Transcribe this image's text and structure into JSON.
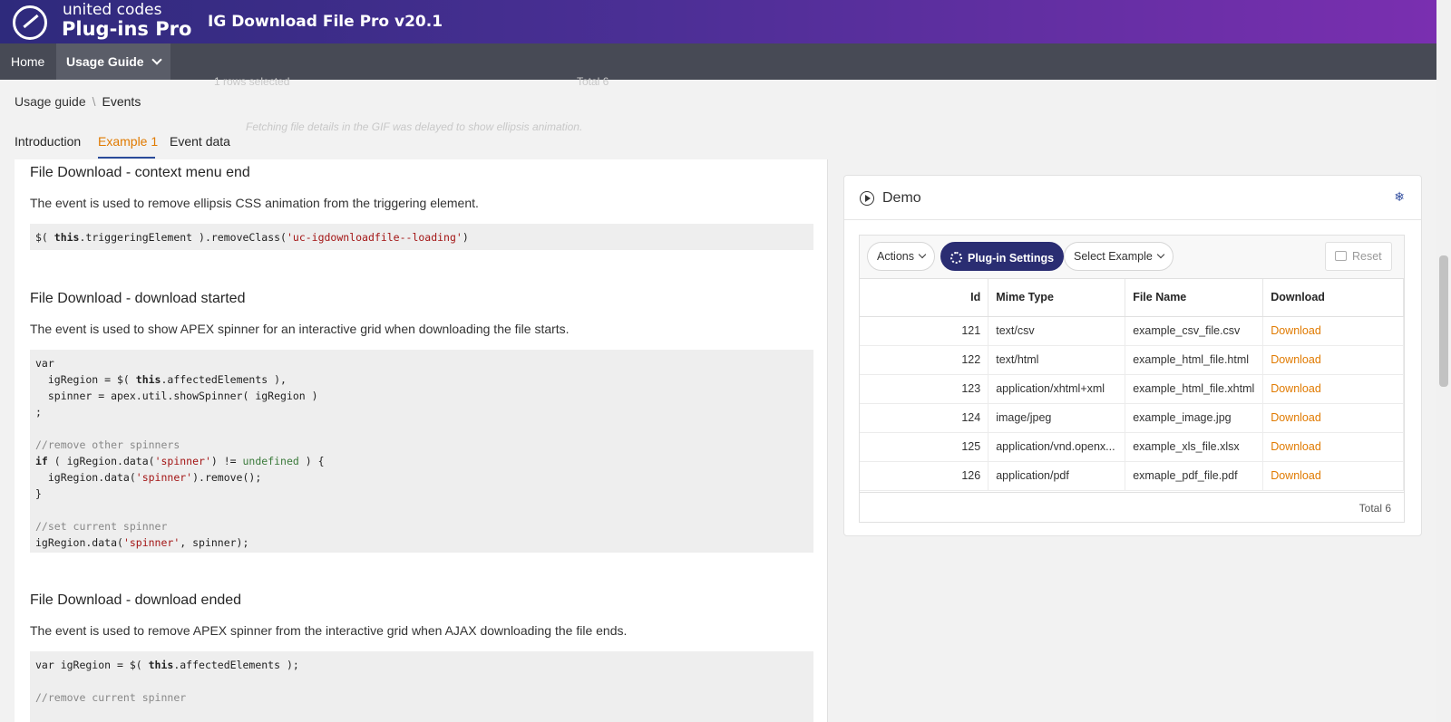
{
  "header": {
    "brand_small": "united codes",
    "brand_big": "Plug-ins Pro",
    "app_title": "IG Download File Pro v20.1"
  },
  "nav": {
    "home": "Home",
    "usage_guide": "Usage Guide"
  },
  "ghost": {
    "rows_selected": "1 rows selected",
    "total": "Total 6",
    "note": "Fetching file details in the GIF was delayed to show ellipsis animation."
  },
  "breadcrumb": {
    "parent": "Usage guide",
    "current": "Events"
  },
  "tabs": [
    "Introduction",
    "Example 1",
    "Event data"
  ],
  "sections": [
    {
      "title": "File Download - context menu end",
      "text": "The event is used to remove ellipsis CSS animation from the triggering element."
    },
    {
      "title": "File Download - download started",
      "text": "The event is used to show APEX spinner for an interactive grid when downloading the file starts."
    },
    {
      "title": "File Download - download ended",
      "text": "The event is used to remove APEX spinner from the interactive grid when AJAX downloading the file ends."
    }
  ],
  "demo": {
    "title": "Demo",
    "toolbar": {
      "actions": "Actions",
      "plugin_settings": "Plug-in Settings",
      "select_example": "Select Example",
      "reset": "Reset"
    },
    "columns": [
      "Id",
      "Mime Type",
      "File Name",
      "Download"
    ],
    "rows": [
      {
        "id": "121",
        "mime": "text/csv",
        "file": "example_csv_file.csv",
        "download": "Download"
      },
      {
        "id": "122",
        "mime": "text/html",
        "file": "example_html_file.html",
        "download": "Download"
      },
      {
        "id": "123",
        "mime": "application/xhtml+xml",
        "file": "example_html_file.xhtml",
        "download": "Download"
      },
      {
        "id": "124",
        "mime": "image/jpeg",
        "file": "example_image.jpg",
        "download": "Download"
      },
      {
        "id": "125",
        "mime": "application/vnd.openx...",
        "file": "example_xls_file.xlsx",
        "download": "Download"
      },
      {
        "id": "126",
        "mime": "application/pdf",
        "file": "exmaple_pdf_file.pdf",
        "download": "Download"
      }
    ],
    "footer_total": "Total 6"
  },
  "colors": {
    "accent_orange": "#e07a00",
    "primary_button": "#2a2d72",
    "nav_bg": "#474a55"
  }
}
